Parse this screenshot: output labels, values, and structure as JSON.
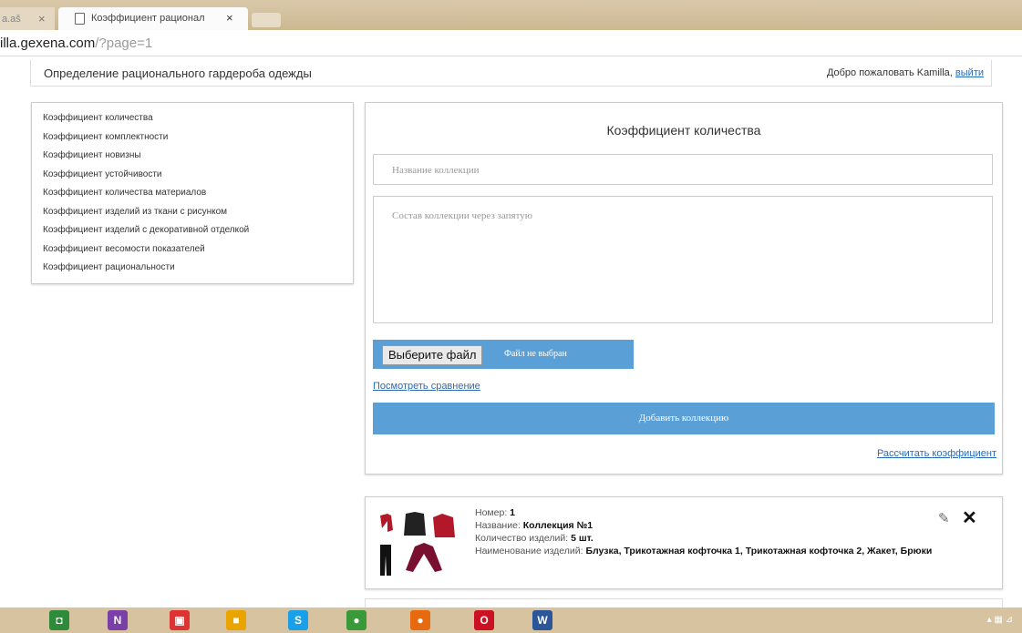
{
  "browser": {
    "prev_tab": {
      "title": "a.aš",
      "close": "×"
    },
    "active_tab": {
      "title": "Коэффициент рационал",
      "close": "×"
    },
    "address": {
      "host": "illa.gexena.com",
      "path": "/?page=1"
    }
  },
  "header": {
    "site_title": "Определение рационального гардероба одежды",
    "welcome_text": "Добро пожаловать Kamilla,",
    "logout_label": "выйти"
  },
  "sidebar": {
    "items": [
      {
        "label": "Коэффициент количества"
      },
      {
        "label": "Коэффициент комплектности"
      },
      {
        "label": "Коэффициент новизны"
      },
      {
        "label": "Коэффициент устойчивости"
      },
      {
        "label": "Коэффициент количества материалов"
      },
      {
        "label": "Коэффициент изделий из ткани с рисунком"
      },
      {
        "label": "Коэффициент изделий с декоративной отделкой"
      },
      {
        "label": "Коэффициент весомости показателей"
      },
      {
        "label": "Коэффициент рациональности"
      }
    ]
  },
  "form": {
    "title": "Коэффициент количества",
    "name_placeholder": "Название коллекции",
    "composition_placeholder": "Состав коллекции через запятую",
    "file_button": "Выберите файл",
    "file_status": "Файл не выбран",
    "compare_link": "Посмотреть сравнение",
    "add_button": "Добавить коллекцию",
    "calc_link": "Рассчитать коэффициент"
  },
  "collection": {
    "number_label": "Номер:",
    "number": "1",
    "name_label": "Название:",
    "name": "Коллекция №1",
    "count_label": "Количество изделий:",
    "count": "5 шт.",
    "items_label": "Наименование изделий:",
    "items": "Блузка, Трикотажная кофточка 1, Трикотажная кофточка 2, Жакет, Брюки",
    "edit_icon": "✎",
    "delete_icon": "✕"
  },
  "taskbar": {
    "icons": [
      {
        "name": "store-icon",
        "glyph": "◘",
        "color": "#2e8b3a"
      },
      {
        "name": "onenote-icon",
        "glyph": "N",
        "color": "#7b3fa8"
      },
      {
        "name": "photos-icon",
        "glyph": "▣",
        "color": "#d33"
      },
      {
        "name": "files-icon",
        "glyph": "■",
        "color": "#e9a400"
      },
      {
        "name": "skype-icon",
        "glyph": "S",
        "color": "#1aa0e8"
      },
      {
        "name": "chrome-icon",
        "glyph": "●",
        "color": "#3a9a3a"
      },
      {
        "name": "firefox-icon",
        "glyph": "●",
        "color": "#e86a10"
      },
      {
        "name": "opera-icon",
        "glyph": "O",
        "color": "#cc1122"
      },
      {
        "name": "word-icon",
        "glyph": "W",
        "color": "#2b579a"
      }
    ],
    "tray": "▴ ▦ ⊿"
  }
}
